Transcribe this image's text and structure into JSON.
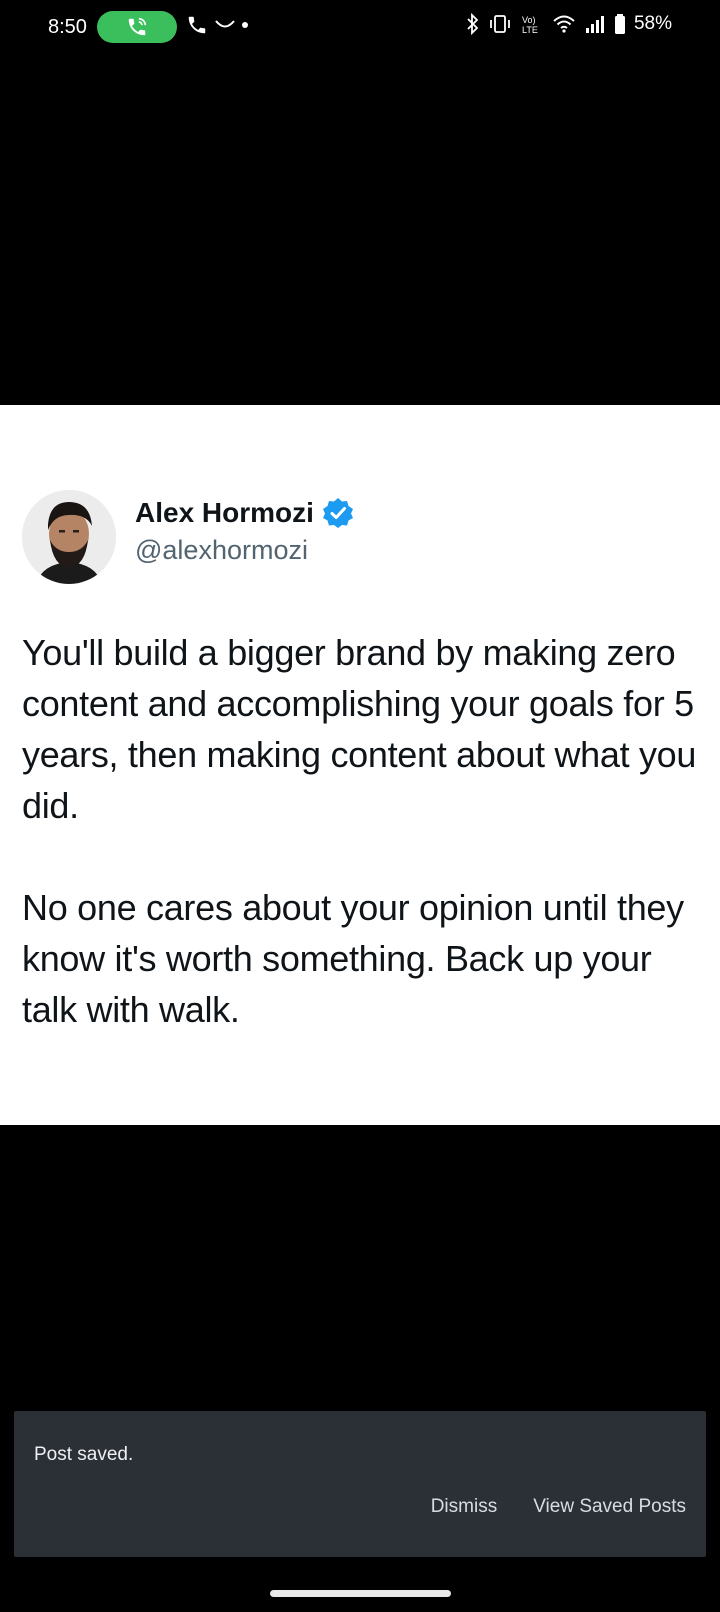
{
  "status_bar": {
    "time": "8:50",
    "battery": "58%",
    "icons": [
      "phone-call-icon",
      "phone-icon",
      "missed-call-icon",
      "bluetooth-icon",
      "vibrate-icon",
      "volte-icon",
      "wifi-icon",
      "signal-icon",
      "battery-icon"
    ]
  },
  "tweet": {
    "author_name": "Alex Hormozi",
    "author_handle": "@alexhormozi",
    "verified": true,
    "paragraphs": [
      "You'll build a bigger brand by making zero content and accomplishing your goals for 5 years, then making content about what you did.",
      "No one cares about your opinion until they know it's worth something. Back up your talk with walk."
    ]
  },
  "snackbar": {
    "message": "Post saved.",
    "dismiss_label": "Dismiss",
    "view_label": "View Saved Posts"
  },
  "colors": {
    "call_pill": "#3bbf5c",
    "verified_blue": "#1d9bf0",
    "snackbar_bg": "#2b2f36"
  }
}
